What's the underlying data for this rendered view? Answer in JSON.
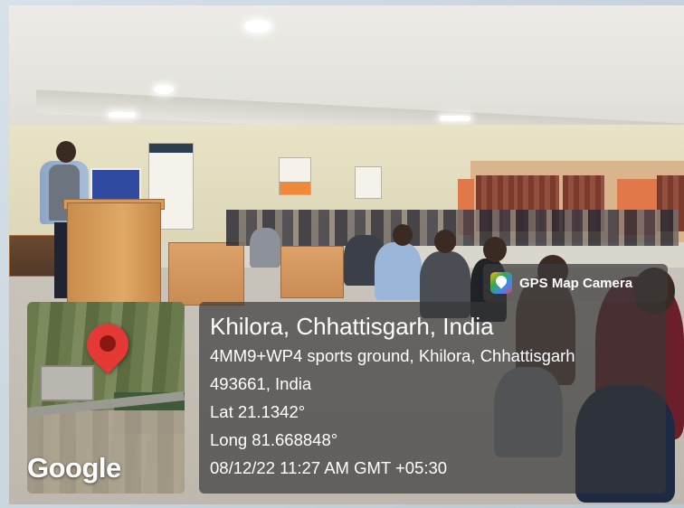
{
  "gps_badge": {
    "label": "GPS Map Camera",
    "icon": "gps-map-camera-app-icon"
  },
  "map": {
    "provider_logo": "Google",
    "pin_icon": "map-pin-icon",
    "pin_color": "#e53935"
  },
  "location": {
    "title": "Khilora, Chhattisgarh, India",
    "address_line1": "4MM9+WP4 sports ground, Khilora, Chhattisgarh",
    "address_line2": "493661, India",
    "latitude": "Lat 21.1342°",
    "longitude": "Long 81.668848°",
    "timestamp": "08/12/22 11:27 AM GMT +05:30"
  }
}
